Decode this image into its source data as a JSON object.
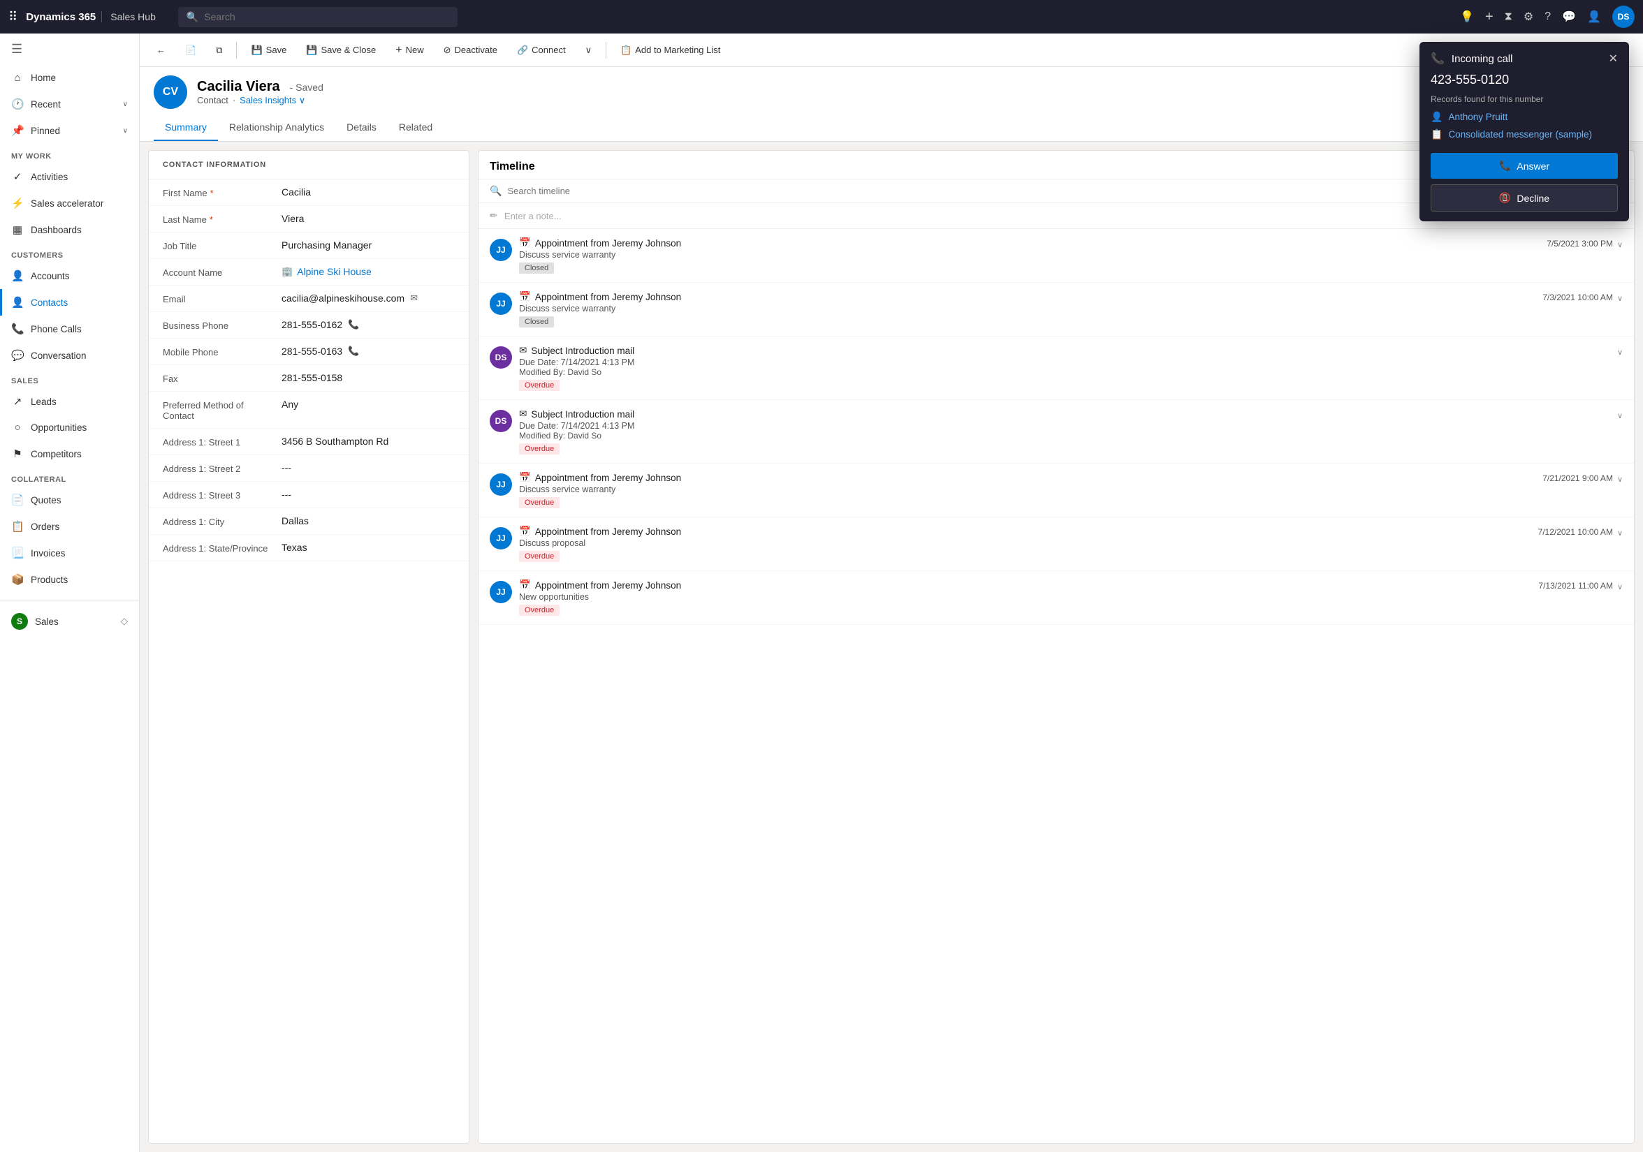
{
  "topNav": {
    "brand": "Dynamics 365",
    "app": "Sales Hub",
    "searchPlaceholder": "Search",
    "avatar": "DS"
  },
  "sidebar": {
    "collapseIcon": "☰",
    "topItems": [
      {
        "id": "home",
        "label": "Home",
        "icon": "⌂"
      },
      {
        "id": "recent",
        "label": "Recent",
        "icon": "🕐",
        "hasChevron": true
      },
      {
        "id": "pinned",
        "label": "Pinned",
        "icon": "📌",
        "hasChevron": true
      }
    ],
    "sections": [
      {
        "label": "My Work",
        "items": [
          {
            "id": "activities",
            "label": "Activities",
            "icon": "✓"
          },
          {
            "id": "sales-accelerator",
            "label": "Sales accelerator",
            "icon": "⚡"
          },
          {
            "id": "dashboards",
            "label": "Dashboards",
            "icon": "▦"
          }
        ]
      },
      {
        "label": "Customers",
        "items": [
          {
            "id": "accounts",
            "label": "Accounts",
            "icon": "👤"
          },
          {
            "id": "contacts",
            "label": "Contacts",
            "icon": "👤",
            "active": true
          },
          {
            "id": "phone-calls",
            "label": "Phone Calls",
            "icon": "📞"
          },
          {
            "id": "conversation",
            "label": "Conversation",
            "icon": "💬"
          }
        ]
      },
      {
        "label": "Sales",
        "items": [
          {
            "id": "leads",
            "label": "Leads",
            "icon": "↗"
          },
          {
            "id": "opportunities",
            "label": "Opportunities",
            "icon": "○"
          },
          {
            "id": "competitors",
            "label": "Competitors",
            "icon": "⚑"
          }
        ]
      },
      {
        "label": "Collateral",
        "items": [
          {
            "id": "quotes",
            "label": "Quotes",
            "icon": "📄"
          },
          {
            "id": "orders",
            "label": "Orders",
            "icon": "📋"
          },
          {
            "id": "invoices",
            "label": "Invoices",
            "icon": "📃"
          },
          {
            "id": "products",
            "label": "Products",
            "icon": "📦"
          }
        ]
      },
      {
        "label": "Sales",
        "items": [
          {
            "id": "sales-bottom",
            "label": "Sales",
            "icon": "S"
          }
        ]
      }
    ]
  },
  "commandBar": {
    "backIcon": "←",
    "pageIcon": "📄",
    "copyIcon": "⧉",
    "saveLabel": "Save",
    "saveIcon": "💾",
    "saveCloseLabel": "Save & Close",
    "newLabel": "New",
    "newIcon": "+",
    "deactivateLabel": "Deactivate",
    "deactivateIcon": "⊘",
    "connectLabel": "Connect",
    "connectIcon": "🔗",
    "chevronDown": "∨",
    "addToMarketingLabel": "Add to Marketing List",
    "moreLabel": "...",
    "topRightIcons": [
      "↻",
      "⤢"
    ]
  },
  "record": {
    "initials": "CV",
    "name": "Cacilia Viera",
    "savedLabel": "- Saved",
    "type": "Contact",
    "dotSeparator": "·",
    "salesInsights": "Sales Insights",
    "salesInsightsChevron": "∨",
    "tabs": [
      {
        "id": "summary",
        "label": "Summary",
        "active": true
      },
      {
        "id": "relationship",
        "label": "Relationship Analytics"
      },
      {
        "id": "details",
        "label": "Details"
      },
      {
        "id": "related",
        "label": "Related"
      }
    ]
  },
  "contactInfo": {
    "sectionTitle": "CONTACT INFORMATION",
    "fields": [
      {
        "label": "First Name",
        "value": "Cacilia",
        "required": true
      },
      {
        "label": "Last Name",
        "value": "Viera",
        "required": true
      },
      {
        "label": "Job Title",
        "value": "Purchasing Manager",
        "required": false
      },
      {
        "label": "Account Name",
        "value": "Alpine Ski House",
        "isLink": true,
        "required": false
      },
      {
        "label": "Email",
        "value": "cacilia@alpineskihouse.com",
        "hasEmailIcon": true,
        "required": false
      },
      {
        "label": "Business Phone",
        "value": "281-555-0162",
        "hasPhoneIcon": true,
        "required": false
      },
      {
        "label": "Mobile Phone",
        "value": "281-555-0163",
        "hasPhoneIcon": true,
        "required": false
      },
      {
        "label": "Fax",
        "value": "281-555-0158",
        "required": false
      },
      {
        "label": "Preferred Method of Contact",
        "value": "Any",
        "required": false
      },
      {
        "label": "Address 1: Street 1",
        "value": "3456 B Southampton Rd",
        "required": false
      },
      {
        "label": "Address 1: Street 2",
        "value": "---",
        "required": false
      },
      {
        "label": "Address 1: Street 3",
        "value": "---",
        "required": false
      },
      {
        "label": "Address 1: City",
        "value": "Dallas",
        "required": false
      },
      {
        "label": "Address 1: State/Province",
        "value": "Texas",
        "required": false
      }
    ]
  },
  "timeline": {
    "title": "Timeline",
    "searchPlaceholder": "Search timeline",
    "notePlaceholder": "Enter a note...",
    "items": [
      {
        "id": "item1",
        "avatarInitials": "JJ",
        "avatarColor": "blue",
        "icon": "📅",
        "title": "Appointment from Jeremy Johnson",
        "subtitle": "Discuss service warranty",
        "badge": "Closed",
        "badgeType": "closed",
        "date": "7/5/2021 3:00 PM",
        "hasChevron": true
      },
      {
        "id": "item2",
        "avatarInitials": "JJ",
        "avatarColor": "blue",
        "icon": "📅",
        "title": "Appointment from Jeremy Johnson",
        "subtitle": "Discuss service warranty",
        "badge": "Closed",
        "badgeType": "closed",
        "date": "7/3/2021 10:00 AM",
        "hasChevron": true
      },
      {
        "id": "item3",
        "avatarInitials": "DS",
        "avatarColor": "purple",
        "icon": "✉",
        "title": "Subject Introduction mail",
        "subtitle": "Due Date: 7/14/2021 4:13 PM",
        "meta": "Modified By: David So",
        "badge": "Overdue",
        "badgeType": "overdue",
        "date": "",
        "hasChevron": true
      },
      {
        "id": "item4",
        "avatarInitials": "DS",
        "avatarColor": "purple",
        "icon": "✉",
        "title": "Subject Introduction mail",
        "subtitle": "Due Date: 7/14/2021 4:13 PM",
        "meta": "Modified By: David So",
        "badge": "Overdue",
        "badgeType": "overdue",
        "date": "",
        "hasChevron": true
      },
      {
        "id": "item5",
        "avatarInitials": "JJ",
        "avatarColor": "blue",
        "icon": "📅",
        "title": "Appointment from Jeremy Johnson",
        "subtitle": "Discuss service warranty",
        "badge": "Overdue",
        "badgeType": "overdue",
        "date": "7/21/2021 9:00 AM",
        "hasChevron": true
      },
      {
        "id": "item6",
        "avatarInitials": "JJ",
        "avatarColor": "blue",
        "icon": "📅",
        "title": "Appointment from Jeremy Johnson",
        "subtitle": "Discuss proposal",
        "badge": "Overdue",
        "badgeType": "overdue",
        "date": "7/12/2021 10:00 AM",
        "hasChevron": true
      },
      {
        "id": "item7",
        "avatarInitials": "JJ",
        "avatarColor": "blue",
        "icon": "📅",
        "title": "Appointment from Jeremy Johnson",
        "subtitle": "New opportunities",
        "badge": "Overdue",
        "badgeType": "overdue",
        "date": "7/13/2021 11:00 AM",
        "hasChevron": true
      }
    ]
  },
  "incomingCall": {
    "title": "Incoming call",
    "phoneIcon": "📞",
    "number": "423-555-0120",
    "recordsLabel": "Records found for this number",
    "records": [
      {
        "label": "Anthony Pruitt",
        "icon": "👤"
      },
      {
        "label": "Consolidated messenger (sample)",
        "icon": "📋"
      }
    ],
    "answerLabel": "Answer",
    "declineLabel": "Decline"
  }
}
